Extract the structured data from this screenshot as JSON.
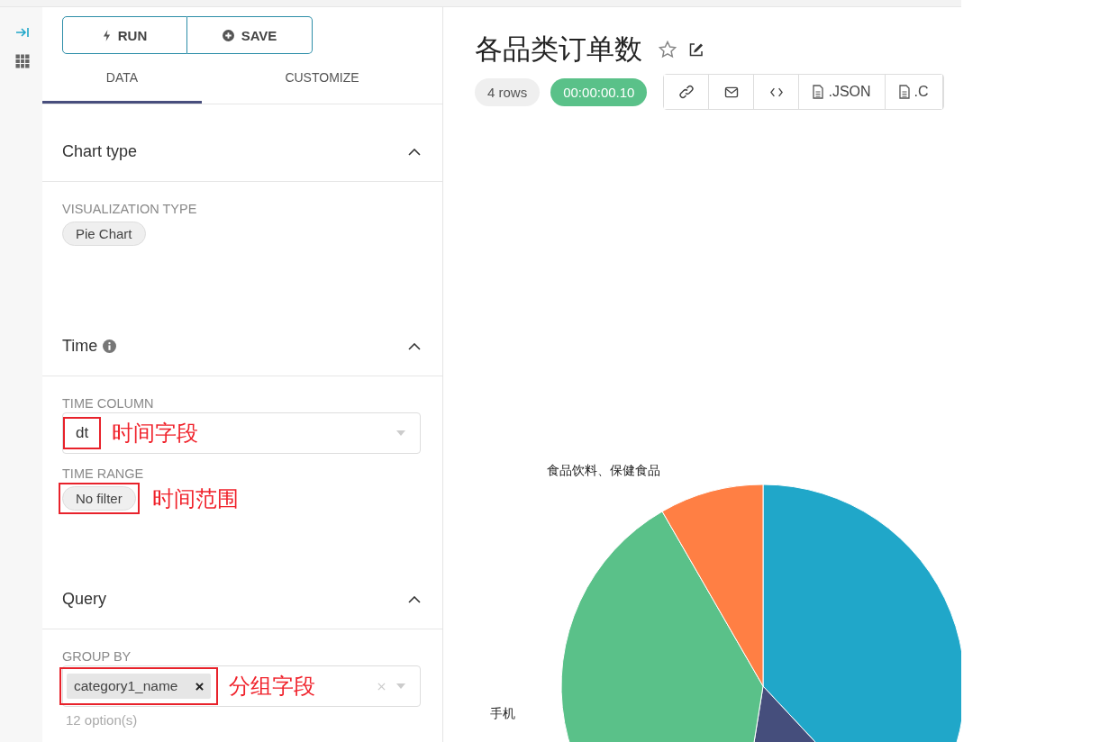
{
  "toolbar": {
    "run": "RUN",
    "save": "SAVE"
  },
  "tabs": [
    {
      "label": "DATA",
      "selected": true
    },
    {
      "label": "CUSTOMIZE",
      "selected": false
    }
  ],
  "sections": [
    {
      "title": "Chart type",
      "info": false,
      "expanded": true,
      "fields": [
        {
          "kind": "chip",
          "label": "VISUALIZATION TYPE",
          "value": "Pie Chart"
        }
      ]
    },
    {
      "title": "Time",
      "info": true,
      "expanded": true,
      "fields": [
        {
          "kind": "select",
          "label": "TIME COLUMN",
          "value": "dt",
          "annotation": "时间字段"
        },
        {
          "kind": "chip",
          "label": "TIME RANGE",
          "value": "No filter",
          "annotation": "时间范围"
        }
      ]
    },
    {
      "title": "Query",
      "info": false,
      "expanded": true,
      "fields": [
        {
          "kind": "multiselect",
          "label": "GROUP BY",
          "value": "category1_name",
          "annotation": "分组字段",
          "note": "12 option(s)"
        }
      ]
    }
  ],
  "chart_header": {
    "title": "各品类订单数",
    "starred": false,
    "rows": "4 rows",
    "timer": "00:00:00.10",
    "actions": [
      {
        "kind": "link"
      },
      {
        "kind": "mail"
      },
      {
        "kind": "embed"
      },
      {
        "kind": "json",
        "label": ".JSON"
      },
      {
        "kind": "csv",
        "label": ".C"
      }
    ]
  },
  "pie_labels": [
    {
      "label": "食品饮料、保健食品"
    },
    {
      "label": "手机"
    }
  ]
}
